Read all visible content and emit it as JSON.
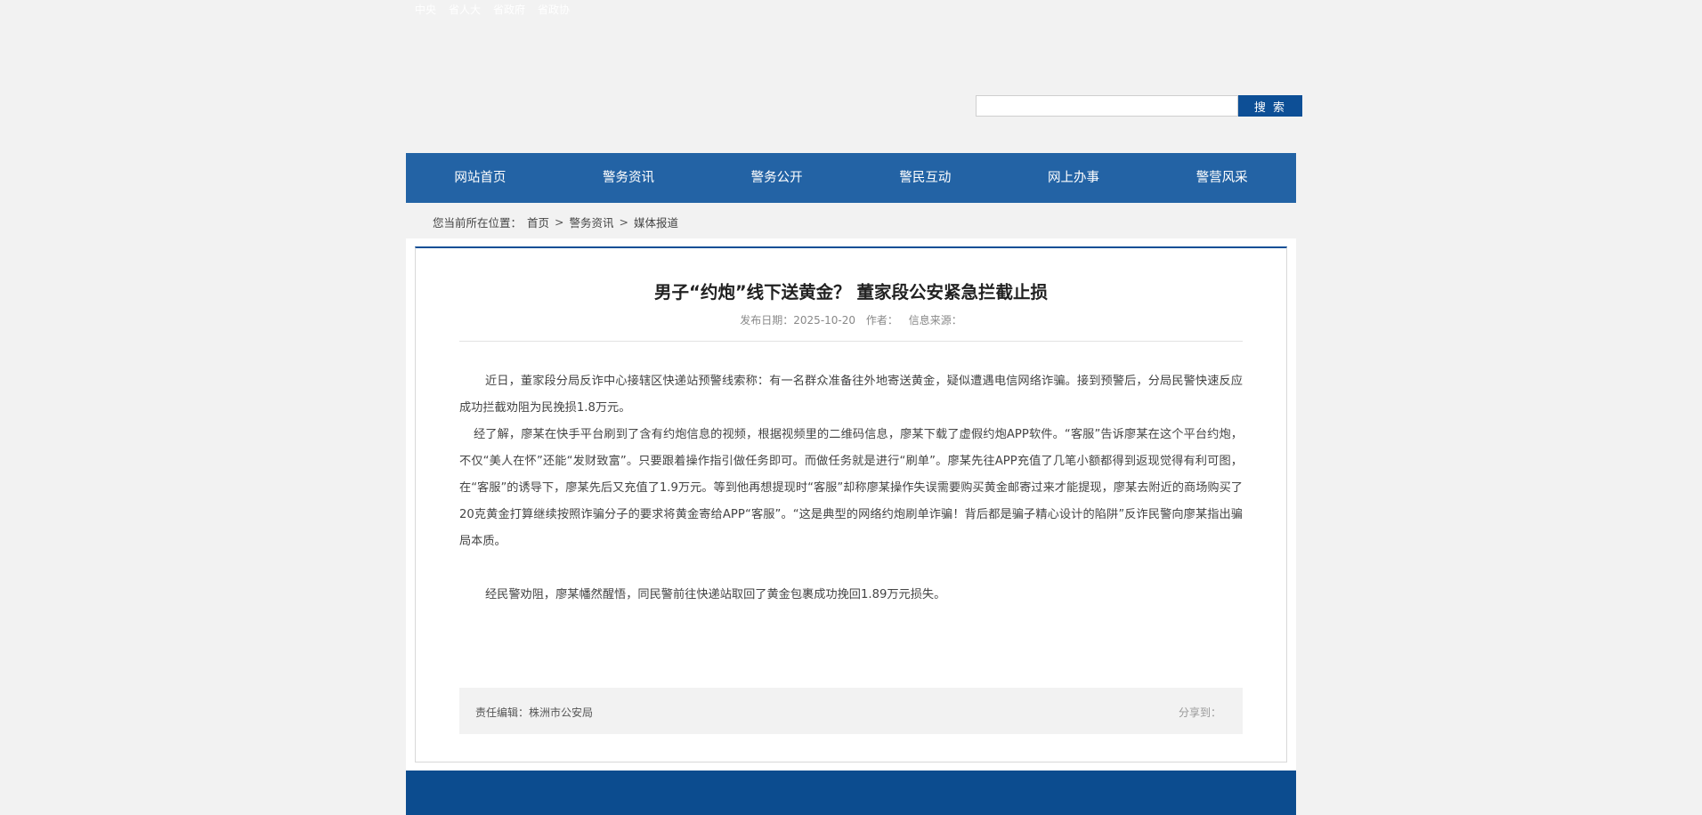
{
  "toplinks": [
    "中央",
    "省人大",
    "省政府",
    "省政协"
  ],
  "search": {
    "value": "",
    "placeholder": "",
    "button_label": "搜 索"
  },
  "nav": {
    "items": [
      {
        "label": "网站首页"
      },
      {
        "label": "警务资讯"
      },
      {
        "label": "警务公开"
      },
      {
        "label": "警民互动"
      },
      {
        "label": "网上办事"
      },
      {
        "label": "警营风采"
      }
    ]
  },
  "breadcrumb": {
    "prefix": "您当前所在位置：",
    "items": [
      "首页",
      "警务资讯",
      "媒体报道"
    ],
    "separator": ">"
  },
  "article": {
    "title": "男子“约炮”线下送黄金？ 董家段公安紧急拦截止损",
    "meta": {
      "date_label": "发布日期：2025-10-20",
      "author_label": "作者：",
      "source_label": "信息来源："
    },
    "paragraphs": [
      "近日，董家段分局反诈中心接辖区快递站预警线索称：有一名群众准备往外地寄送黄金，疑似遭遇电信网络诈骗。接到预警后，分局民警快速反应成功拦截劝阻为民挽损1.8万元。",
      "经了解，廖某在快手平台刷到了含有约炮信息的视频，根据视频里的二维码信息，廖某下载了虚假约炮APP软件。“客服”告诉廖某在这个平台约炮，不仅“美人在怀”还能“发财致富”。只要跟着操作指引做任务即可。而做任务就是进行“刷单”。廖某先往APP充值了几笔小额都得到返现觉得有利可图，在“客服”的诱导下，廖某先后又充值了1.9万元。等到他再想提现时“客服”却称廖某操作失误需要购买黄金邮寄过来才能提现，廖某去附近的商场购买了20克黄金打算继续按照诈骗分子的要求将黄金寄给APP“客服”。“这是典型的网络约炮刷单诈骗！背后都是骗子精心设计的陷阱”反诈民警向廖某指出骗局本质。",
      "经民警劝阻，廖某幡然醒悟，同民警前往快递站取回了黄金包裹成功挽回1.89万元损失。"
    ],
    "editor_label": "责任编辑：株洲市公安局",
    "share_label": "分享到："
  },
  "colors": {
    "nav_bg": "#2363a5",
    "accent": "#0d4f96",
    "bottom_band": "#0c4c8f",
    "page_bg": "#f2f2f2"
  }
}
